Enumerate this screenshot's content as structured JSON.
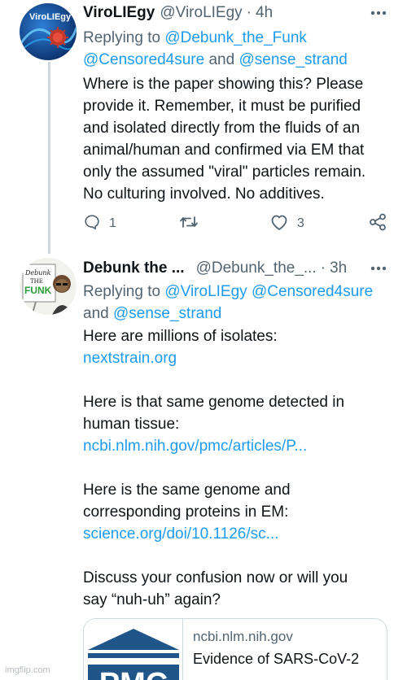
{
  "tweet1": {
    "display_name": "ViroLIEgy",
    "handle": "@ViroLIEgy",
    "separator": "·",
    "time": "4h",
    "avatar_logo_text": "ViroLIEgy",
    "replying_to_label": "Replying to",
    "mention_1": "@Debunk_the_Funk",
    "mention_2": "@Censored4sure",
    "and_label": "and",
    "mention_3": "@sense_strand",
    "body_lines": [
      "Where is the paper showing this? Please",
      "provide it. Remember, it must be purified",
      "and isolated directly from the fluids of an",
      "animal/human and confirmed via EM that",
      "only the assumed \"viral\" particles remain.",
      "No culturing involved. No additives."
    ],
    "actions": {
      "reply_count": "1",
      "like_count": "3"
    }
  },
  "tweet2": {
    "display_name": "Debunk the ...",
    "handle": "@Debunk_the_...",
    "separator": "·",
    "time": "3h",
    "avatar_sign_text": "Debunk the FUNK",
    "replying_to_label": "Replying to",
    "mention_1": "@ViroLIEgy",
    "mention_2": "@Censored4sure",
    "and_label": "and",
    "mention_3": "@sense_strand",
    "body": {
      "line_1": "Here are millions of isolates:",
      "link_1": "nextstrain.org",
      "line_2": "Here is that same genome detected in",
      "line_3": "human tissue:",
      "link_2": "ncbi.nlm.nih.gov/pmc/articles/P...",
      "line_4": "Here is the same genome and",
      "line_5": "corresponding proteins in EM:",
      "link_3": "science.org/doi/10.1126/sc...",
      "line_6": "Discuss your confusion now or will you",
      "line_7": "say “nuh-uh” again?"
    },
    "card": {
      "thumb_text": "PMC",
      "domain": "ncbi.nlm.nih.gov",
      "title": "Evidence of SARS-CoV-2"
    }
  },
  "watermark": "imgflip.com",
  "colors": {
    "link_blue": "#1d9bf0",
    "secondary_gray": "#536471",
    "text_dark": "#0f1419",
    "border": "#cfd9de",
    "pmc_blue": "#20558a"
  },
  "icons": [
    "more-icon",
    "reply-icon",
    "retweet-icon",
    "like-icon",
    "share-icon"
  ]
}
